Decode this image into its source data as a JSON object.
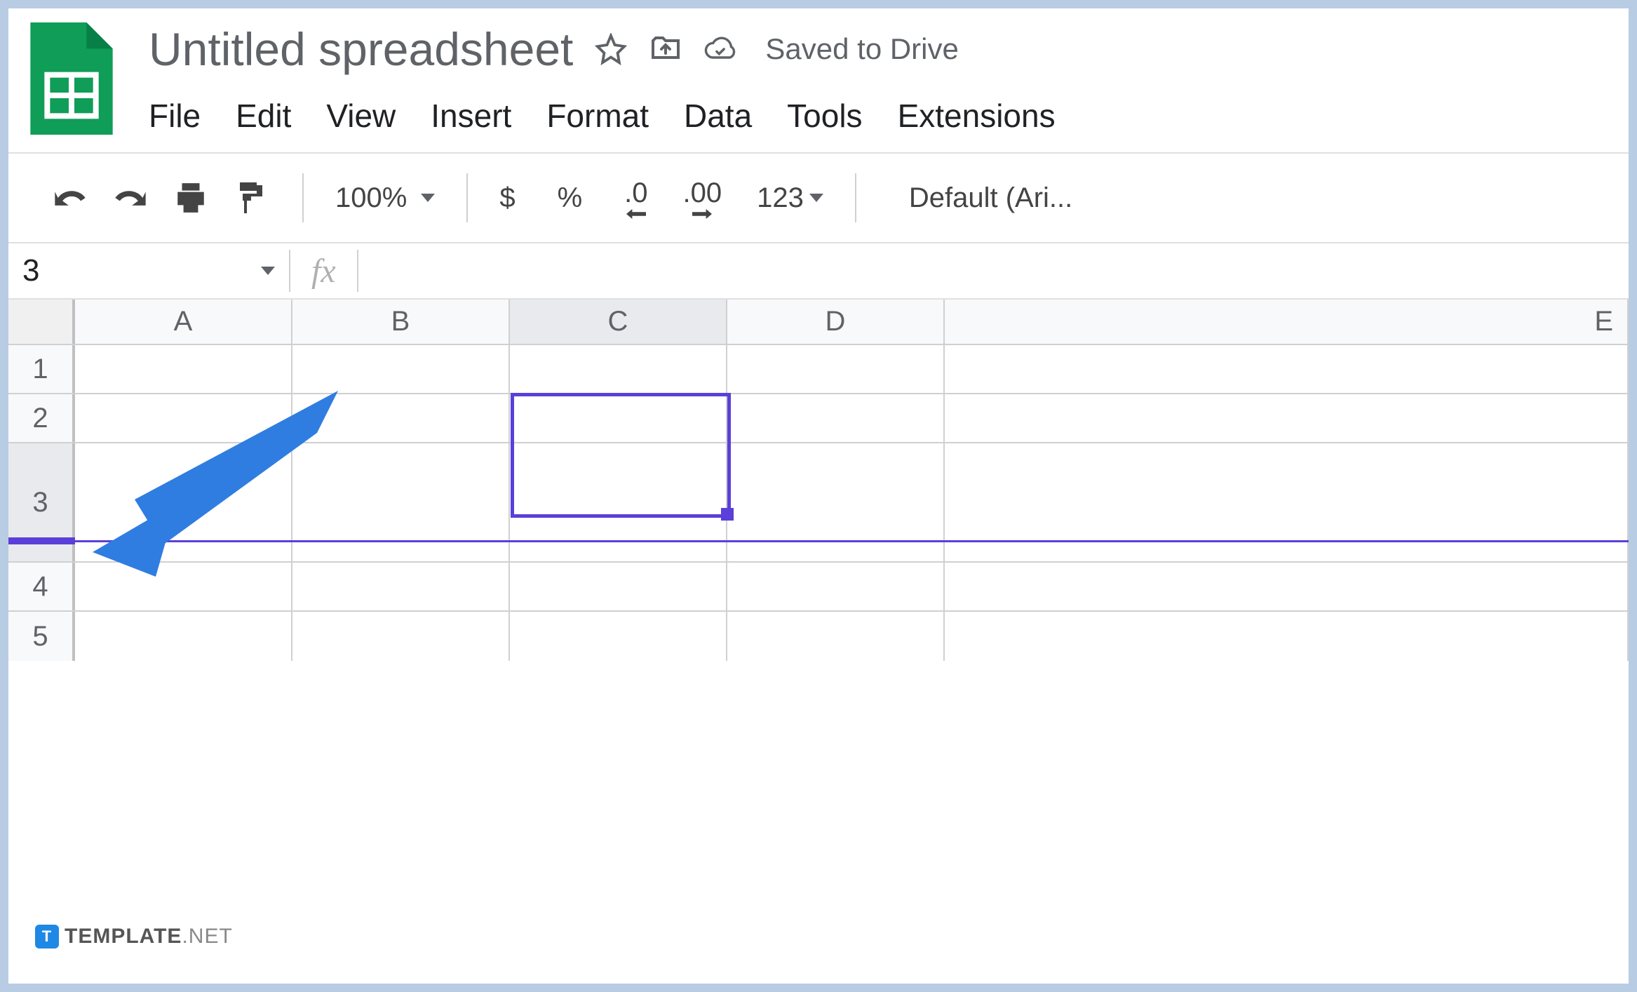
{
  "header": {
    "title": "Untitled spreadsheet",
    "save_status": "Saved to Drive"
  },
  "menu": {
    "items": [
      "File",
      "Edit",
      "View",
      "Insert",
      "Format",
      "Data",
      "Tools",
      "Extensions"
    ]
  },
  "toolbar": {
    "zoom": "100%",
    "currency": "$",
    "percent": "%",
    "dec_decrease": ".0",
    "dec_increase": ".00",
    "number_format": "123",
    "font": "Default (Ari..."
  },
  "formula_bar": {
    "name_box": "3",
    "fx_label": "fx"
  },
  "grid": {
    "columns": [
      "A",
      "B",
      "C",
      "D",
      "E"
    ],
    "rows": [
      "1",
      "2",
      "3",
      "4",
      "5"
    ],
    "selected_column_index": 2,
    "selected_row_index": 2,
    "selected_cell": "C3"
  },
  "watermark": {
    "brand_bold": "TEMPLATE",
    "brand_ext": ".NET"
  }
}
